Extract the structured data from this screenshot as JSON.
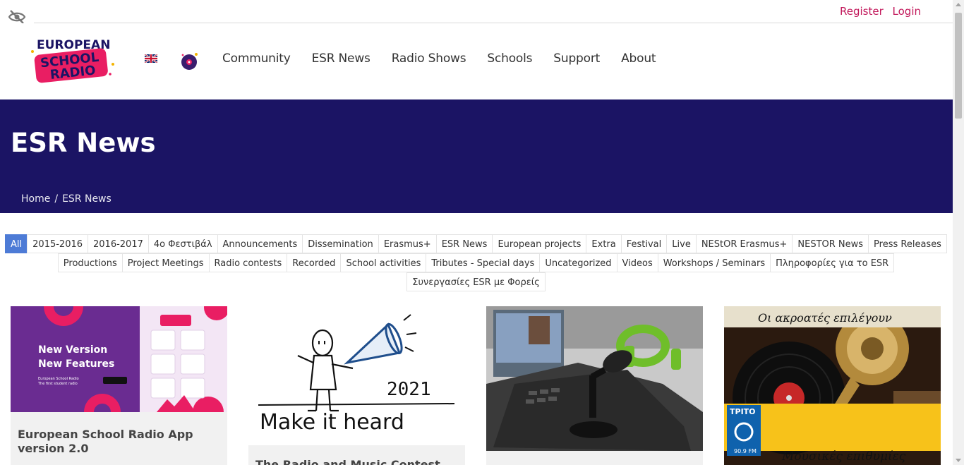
{
  "util": {
    "register": "Register",
    "login": "Login"
  },
  "logo": {
    "line1": "EUROPEAN",
    "line2": "SCHOOL",
    "line3": "RADIO"
  },
  "nav": [
    "Community",
    "ESR News",
    "Radio Shows",
    "Schools",
    "Support",
    "About"
  ],
  "hero": {
    "title": "ESR News",
    "crumb_home": "Home",
    "crumb_sep": "/",
    "crumb_current": "ESR News"
  },
  "filters": {
    "row1": [
      "All",
      "2015-2016",
      "2016-2017",
      "4ο Φεστιβάλ",
      "Announcements",
      "Dissemination",
      "Erasmus+",
      "ESR News",
      "European projects",
      "Extra",
      "Festival",
      "Live",
      "NEStOR Erasmus+",
      "NESTOR News",
      "Press Releases"
    ],
    "row2": [
      "Productions",
      "Project Meetings",
      "Radio contests",
      "Recorded",
      "School activities",
      "Tributes - Special days",
      "Uncategorized",
      "Videos",
      "Workshops / Seminars",
      "Πληροφορίες για το ESR"
    ],
    "row3": [
      "Συνεργασίες ESR με Φορείς"
    ]
  },
  "cards": [
    {
      "title": "European School Radio App version 2.0",
      "thumb_line1": "New Version",
      "thumb_line2": "New Features",
      "thumb_small1": "European School Radio",
      "thumb_small2": "The first student radio"
    },
    {
      "title": "The Radio and Music Contest MAKE",
      "thumb_year": "2021",
      "thumb_text": "Make it heard"
    },
    {
      "title": "",
      "thumb_caption": ""
    },
    {
      "title": "",
      "thumb_top": "Οι ακροατές επιλέγουν",
      "thumb_bottom": "Μουσικές επιθυμίες",
      "thumb_logo": "ΤΡΙΤΟ",
      "thumb_freq": "90.9 FM"
    }
  ],
  "colors": {
    "accent": "#c2185b",
    "hero_bg": "#1b1464",
    "active_chip": "#4d7bd6"
  }
}
